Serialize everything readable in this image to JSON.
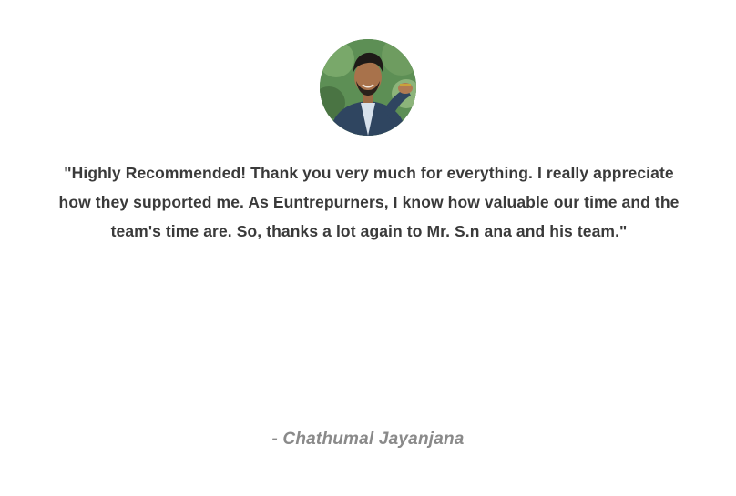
{
  "testimonial": {
    "avatar_icon": "person-photo",
    "quote": "\"Highly Recommended! Thank you very much for everything. I really appreciate how they supported me. As Euntrepurners, I know how valuable our time and the team's time are. So, thanks a lot again to Mr. S.n ana and his team.\"",
    "author": "- Chathumal Jayanjana"
  },
  "colors": {
    "quote_text": "#3a3a3a",
    "author_text": "#8a8a8a",
    "background": "#ffffff"
  }
}
